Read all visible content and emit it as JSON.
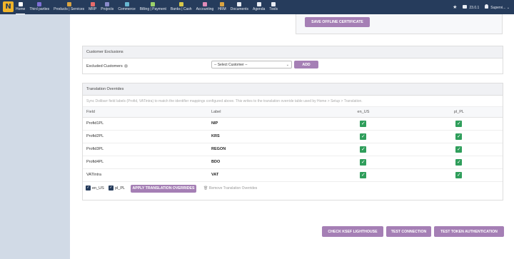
{
  "menu": [
    {
      "label": "Home",
      "color": "#ffffff"
    },
    {
      "label": "Third parties",
      "color": "#7e6fd6"
    },
    {
      "label": "Products | Services",
      "color": "#d9a441"
    },
    {
      "label": "MRP",
      "color": "#e66a6a"
    },
    {
      "label": "Projects",
      "color": "#8a8acb"
    },
    {
      "label": "Commerce",
      "color": "#67b7d1"
    },
    {
      "label": "Billing | Payment",
      "color": "#9bd16a"
    },
    {
      "label": "Banks | Cash",
      "color": "#d8c84a"
    },
    {
      "label": "Accounting",
      "color": "#e08bb8"
    },
    {
      "label": "HRM",
      "color": "#d9a441"
    },
    {
      "label": "Documents",
      "color": "#e8ecf3"
    },
    {
      "label": "Agenda",
      "color": "#e8ecf3"
    },
    {
      "label": "Tools",
      "color": "#e8ecf3"
    }
  ],
  "topright": {
    "version": "23.0.1",
    "user": "Supervi..."
  },
  "cert": {
    "save_label": "SAVE OFFLINE CERTIFICATE"
  },
  "customer": {
    "title": "Customer Exclusions",
    "label": "Excluded Customers",
    "select_value": "-- Select Customer --",
    "add_label": "ADD"
  },
  "translation": {
    "title": "Translation Overrides",
    "help": "Sync Dolibarr field labels (Profid, VATintra) to match the identifier mappings configured above. This writes to the translation override table used by Home > Setup > Translation.",
    "headers": {
      "field": "Field",
      "label": "Label",
      "en": "en_US",
      "pl": "pl_PL"
    },
    "rows": [
      {
        "field": "Profid1PL",
        "label": "NIP"
      },
      {
        "field": "Profid2PL",
        "label": "KRS"
      },
      {
        "field": "Profid3PL",
        "label": "REGON"
      },
      {
        "field": "Profid4PL",
        "label": "BDO"
      },
      {
        "field": "VATIntra",
        "label": "VAT"
      }
    ],
    "check_en": "en_US",
    "check_pl": "pl_PL",
    "apply_label": "APPLY TRANSLATION OVERRIDES",
    "remove_label": "Remove Translation Overrides"
  },
  "actions": {
    "lighthouse": "CHECK KSEF LIGHTHOUSE",
    "connection": "TEST CONNECTION",
    "token": "TEST TOKEN AUTHENTICATION"
  }
}
